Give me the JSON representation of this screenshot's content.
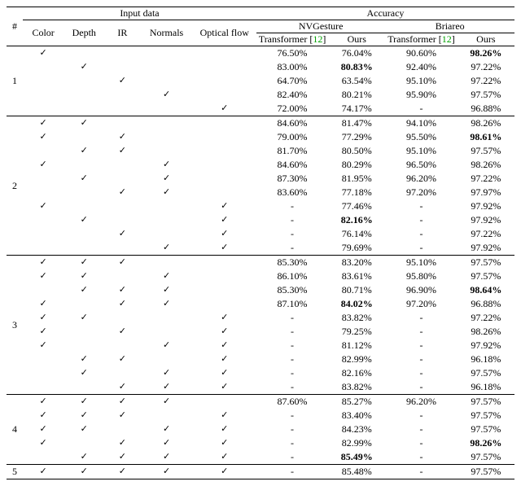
{
  "header": {
    "group_left": "Input data",
    "group_right": "Accuracy",
    "input_cols": [
      "#",
      "Color",
      "Depth",
      "IR",
      "Normals",
      "Optical flow"
    ],
    "acc_groups": [
      "NVGesture",
      "Briareo"
    ],
    "acc_sub": {
      "transf_prefix": "Transformer [",
      "transf_ref": "12",
      "transf_suffix": "]",
      "ours": "Ours"
    }
  },
  "rows": [
    {
      "g": "1",
      "gtop": true,
      "c": [
        1,
        0,
        0,
        0,
        0
      ],
      "nv": [
        "76.50%",
        "76.04%"
      ],
      "br": [
        "90.60%",
        "98.26%"
      ],
      "bold": {
        "br1": true
      }
    },
    {
      "g": "1",
      "c": [
        0,
        1,
        0,
        0,
        0
      ],
      "nv": [
        "83.00%",
        "80.83%"
      ],
      "br": [
        "92.40%",
        "97.22%"
      ],
      "bold": {
        "nv1": true
      }
    },
    {
      "g": "1",
      "c": [
        0,
        0,
        1,
        0,
        0
      ],
      "nv": [
        "64.70%",
        "63.54%"
      ],
      "br": [
        "95.10%",
        "97.22%"
      ]
    },
    {
      "g": "1",
      "c": [
        0,
        0,
        0,
        1,
        0
      ],
      "nv": [
        "82.40%",
        "80.21%"
      ],
      "br": [
        "95.90%",
        "97.57%"
      ]
    },
    {
      "g": "1",
      "gend": true,
      "c": [
        0,
        0,
        0,
        0,
        1
      ],
      "nv": [
        "72.00%",
        "74.17%"
      ],
      "br": [
        "-",
        "96.88%"
      ]
    },
    {
      "g": "2",
      "gtop": true,
      "c": [
        1,
        1,
        0,
        0,
        0
      ],
      "nv": [
        "84.60%",
        "81.47%"
      ],
      "br": [
        "94.10%",
        "98.26%"
      ]
    },
    {
      "g": "2",
      "c": [
        1,
        0,
        1,
        0,
        0
      ],
      "nv": [
        "79.00%",
        "77.29%"
      ],
      "br": [
        "95.50%",
        "98.61%"
      ],
      "bold": {
        "br1": true
      }
    },
    {
      "g": "2",
      "c": [
        0,
        1,
        1,
        0,
        0
      ],
      "nv": [
        "81.70%",
        "80.50%"
      ],
      "br": [
        "95.10%",
        "97.57%"
      ]
    },
    {
      "g": "2",
      "c": [
        1,
        0,
        0,
        1,
        0
      ],
      "nv": [
        "84.60%",
        "80.29%"
      ],
      "br": [
        "96.50%",
        "98.26%"
      ]
    },
    {
      "g": "2",
      "c": [
        0,
        1,
        0,
        1,
        0
      ],
      "nv": [
        "87.30%",
        "81.95%"
      ],
      "br": [
        "96.20%",
        "97.22%"
      ]
    },
    {
      "g": "2",
      "c": [
        0,
        0,
        1,
        1,
        0
      ],
      "nv": [
        "83.60%",
        "77.18%"
      ],
      "br": [
        "97.20%",
        "97.97%"
      ]
    },
    {
      "g": "2",
      "c": [
        1,
        0,
        0,
        0,
        1
      ],
      "nv": [
        "-",
        "77.46%"
      ],
      "br": [
        "-",
        "97.92%"
      ]
    },
    {
      "g": "2",
      "c": [
        0,
        1,
        0,
        0,
        1
      ],
      "nv": [
        "-",
        "82.16%"
      ],
      "br": [
        "-",
        "97.92%"
      ],
      "bold": {
        "nv1": true
      }
    },
    {
      "g": "2",
      "c": [
        0,
        0,
        1,
        0,
        1
      ],
      "nv": [
        "-",
        "76.14%"
      ],
      "br": [
        "-",
        "97.22%"
      ]
    },
    {
      "g": "2",
      "gend": true,
      "c": [
        0,
        0,
        0,
        1,
        1
      ],
      "nv": [
        "-",
        "79.69%"
      ],
      "br": [
        "-",
        "97.92%"
      ]
    },
    {
      "g": "3",
      "gtop": true,
      "c": [
        1,
        1,
        1,
        0,
        0
      ],
      "nv": [
        "85.30%",
        "83.20%"
      ],
      "br": [
        "95.10%",
        "97.57%"
      ]
    },
    {
      "g": "3",
      "c": [
        1,
        1,
        0,
        1,
        0
      ],
      "nv": [
        "86.10%",
        "83.61%"
      ],
      "br": [
        "95.80%",
        "97.57%"
      ]
    },
    {
      "g": "3",
      "c": [
        0,
        1,
        1,
        1,
        0
      ],
      "nv": [
        "85.30%",
        "80.71%"
      ],
      "br": [
        "96.90%",
        "98.64%"
      ],
      "bold": {
        "br1": true
      }
    },
    {
      "g": "3",
      "c": [
        1,
        0,
        1,
        1,
        0
      ],
      "nv": [
        "87.10%",
        "84.02%"
      ],
      "br": [
        "97.20%",
        "96.88%"
      ],
      "bold": {
        "nv1": true
      }
    },
    {
      "g": "3",
      "c": [
        1,
        1,
        0,
        0,
        1
      ],
      "nv": [
        "-",
        "83.82%"
      ],
      "br": [
        "-",
        "97.22%"
      ]
    },
    {
      "g": "3",
      "c": [
        1,
        0,
        1,
        0,
        1
      ],
      "nv": [
        "-",
        "79.25%"
      ],
      "br": [
        "-",
        "98.26%"
      ]
    },
    {
      "g": "3",
      "c": [
        1,
        0,
        0,
        1,
        1
      ],
      "nv": [
        "-",
        "81.12%"
      ],
      "br": [
        "-",
        "97.92%"
      ]
    },
    {
      "g": "3",
      "c": [
        0,
        1,
        1,
        0,
        1
      ],
      "nv": [
        "-",
        "82.99%"
      ],
      "br": [
        "-",
        "96.18%"
      ]
    },
    {
      "g": "3",
      "c": [
        0,
        1,
        0,
        1,
        1
      ],
      "nv": [
        "-",
        "82.16%"
      ],
      "br": [
        "-",
        "97.57%"
      ]
    },
    {
      "g": "3",
      "gend": true,
      "c": [
        0,
        0,
        1,
        1,
        1
      ],
      "nv": [
        "-",
        "83.82%"
      ],
      "br": [
        "-",
        "96.18%"
      ]
    },
    {
      "g": "4",
      "gtop": true,
      "c": [
        1,
        1,
        1,
        1,
        0
      ],
      "nv": [
        "87.60%",
        "85.27%"
      ],
      "br": [
        "96.20%",
        "97.57%"
      ]
    },
    {
      "g": "4",
      "c": [
        1,
        1,
        1,
        0,
        1
      ],
      "nv": [
        "-",
        "83.40%"
      ],
      "br": [
        "-",
        "97.57%"
      ]
    },
    {
      "g": "4",
      "c": [
        1,
        1,
        0,
        1,
        1
      ],
      "nv": [
        "-",
        "84.23%"
      ],
      "br": [
        "-",
        "97.57%"
      ]
    },
    {
      "g": "4",
      "c": [
        1,
        0,
        1,
        1,
        1
      ],
      "nv": [
        "-",
        "82.99%"
      ],
      "br": [
        "-",
        "98.26%"
      ],
      "bold": {
        "br1": true
      }
    },
    {
      "g": "4",
      "gend": true,
      "c": [
        0,
        1,
        1,
        1,
        1
      ],
      "nv": [
        "-",
        "85.49%"
      ],
      "br": [
        "-",
        "97.57%"
      ],
      "bold": {
        "nv1": true
      }
    },
    {
      "g": "5",
      "gtop": true,
      "gend": true,
      "last": true,
      "c": [
        1,
        1,
        1,
        1,
        1
      ],
      "nv": [
        "-",
        "85.48%"
      ],
      "br": [
        "-",
        "97.57%"
      ]
    }
  ],
  "check": "✓"
}
